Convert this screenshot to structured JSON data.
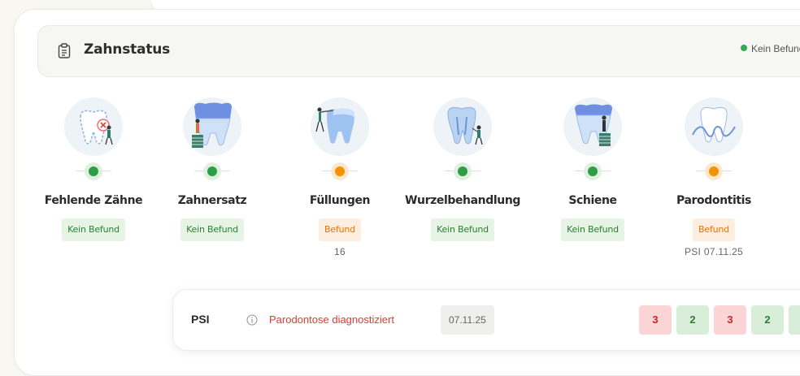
{
  "section": {
    "title": "Zahnstatus",
    "icon": "clipboard-icon",
    "status_label": "Kein Befund",
    "status_color": "#34a853"
  },
  "categories": [
    {
      "label": "Fehlende Zähne",
      "status": "Kein Befund",
      "state": "ok",
      "detail": "",
      "illustration": "missing-tooth-icon"
    },
    {
      "label": "Zahnersatz",
      "status": "Kein Befund",
      "state": "ok",
      "detail": "",
      "illustration": "denture-icon"
    },
    {
      "label": "Füllungen",
      "status": "Befund",
      "state": "warn",
      "detail": "16",
      "illustration": "filling-icon"
    },
    {
      "label": "Wurzelbehandlung",
      "status": "Kein Befund",
      "state": "ok",
      "detail": "",
      "illustration": "root-canal-icon"
    },
    {
      "label": "Schiene",
      "status": "Kein Befund",
      "state": "ok",
      "detail": "",
      "illustration": "splint-icon"
    },
    {
      "label": "Parodontitis",
      "status": "Befund",
      "state": "warn",
      "detail": "PSI 07.11.25",
      "illustration": "periodontitis-icon"
    }
  ],
  "psi": {
    "label": "PSI",
    "info_icon": "info-icon",
    "status": "Parodontose diagnostiziert",
    "date": "07.11.25",
    "scores": [
      {
        "value": "3",
        "state": "red"
      },
      {
        "value": "2",
        "state": "green"
      },
      {
        "value": "3",
        "state": "red"
      },
      {
        "value": "2",
        "state": "green"
      },
      {
        "value": "",
        "state": "green"
      }
    ]
  },
  "colors": {
    "ok": "#2e9e45",
    "warn": "#f39200",
    "alert": "#e53935"
  }
}
